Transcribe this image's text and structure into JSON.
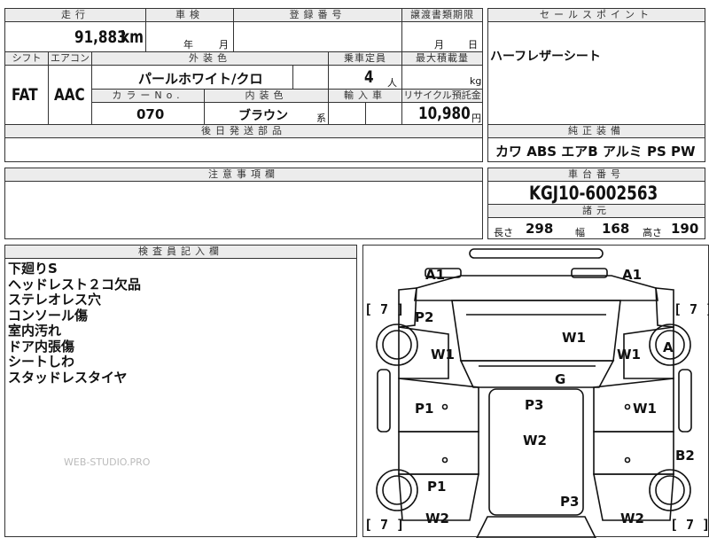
{
  "header": {
    "mileage_label": "走行",
    "shaken_label": "車検",
    "registration_label": "登録番号",
    "transfer_deadline_label": "譲渡書類期限",
    "sales_point_label": "セールスポイント"
  },
  "mileage": {
    "value": "91,883",
    "unit": "km"
  },
  "shaken": {
    "year": "年",
    "month": "月"
  },
  "transfer": {
    "month": "月",
    "day": "日"
  },
  "row2_labels": {
    "shift": "シフト",
    "aircon": "エアコン",
    "exterior_color": "外装色",
    "capacity": "乗車定員",
    "max_load": "最大積載量"
  },
  "shift": "FAT",
  "aircon": "AAC",
  "exterior_color": "パールホワイト/クロ",
  "capacity": {
    "value": "4",
    "unit": "人"
  },
  "max_load": {
    "unit": "kg"
  },
  "row3_labels": {
    "color_no": "カラーNo.",
    "interior_color": "内装色",
    "import": "輸入車",
    "recycle": "リサイクル預託金"
  },
  "color_no": "070",
  "interior_color": {
    "value": "ブラウン",
    "suffix": "系"
  },
  "recycle": {
    "value": "10,980",
    "unit": "円"
  },
  "later_parts_label": "後日発送部品",
  "sales_point": "ハーフレザーシート",
  "standard_equipment": {
    "label": "純正装備",
    "items": "カワ ABS エアB アルミ PS PW"
  },
  "notes_label": "注意事項欄",
  "chassis": {
    "label": "車台番号",
    "value": "KGJ10-6002563"
  },
  "dimensions": {
    "label": "諸元",
    "length_label": "長さ",
    "length": "298",
    "width_label": "幅",
    "width": "168",
    "height_label": "高さ",
    "height": "190"
  },
  "inspector": {
    "label": "検査員記入欄",
    "lines": [
      "下廻りS",
      "ヘッドレスト２コ欠品",
      "ステレオレス穴",
      "コンソール傷",
      "室内汚れ",
      "ドア内張傷",
      "シートしわ",
      "スタッドレスタイヤ"
    ]
  },
  "watermark": "WEB-STUDIO.PRO",
  "diagram": {
    "marks": {
      "a1_left": "A1",
      "a1_right": "A1",
      "seven_tl": "[ 7 ]",
      "seven_tr": "[ 7 ]",
      "seven_bl": "[ 7 ]",
      "seven_br": "[ 7 ]",
      "p2": "P2",
      "w1_hood": "W1",
      "w1_left": "W1",
      "w1_right": "W1",
      "a_tire": "A",
      "g_glass": "G",
      "p1_left": "P1",
      "p3_roof": "P3",
      "w1_rdoor": "W1",
      "w2_roof": "W2",
      "b2": "B2",
      "p1_rear": "P1",
      "p3_rear": "P3",
      "w2_left": "W2",
      "w2_right": "W2"
    }
  }
}
